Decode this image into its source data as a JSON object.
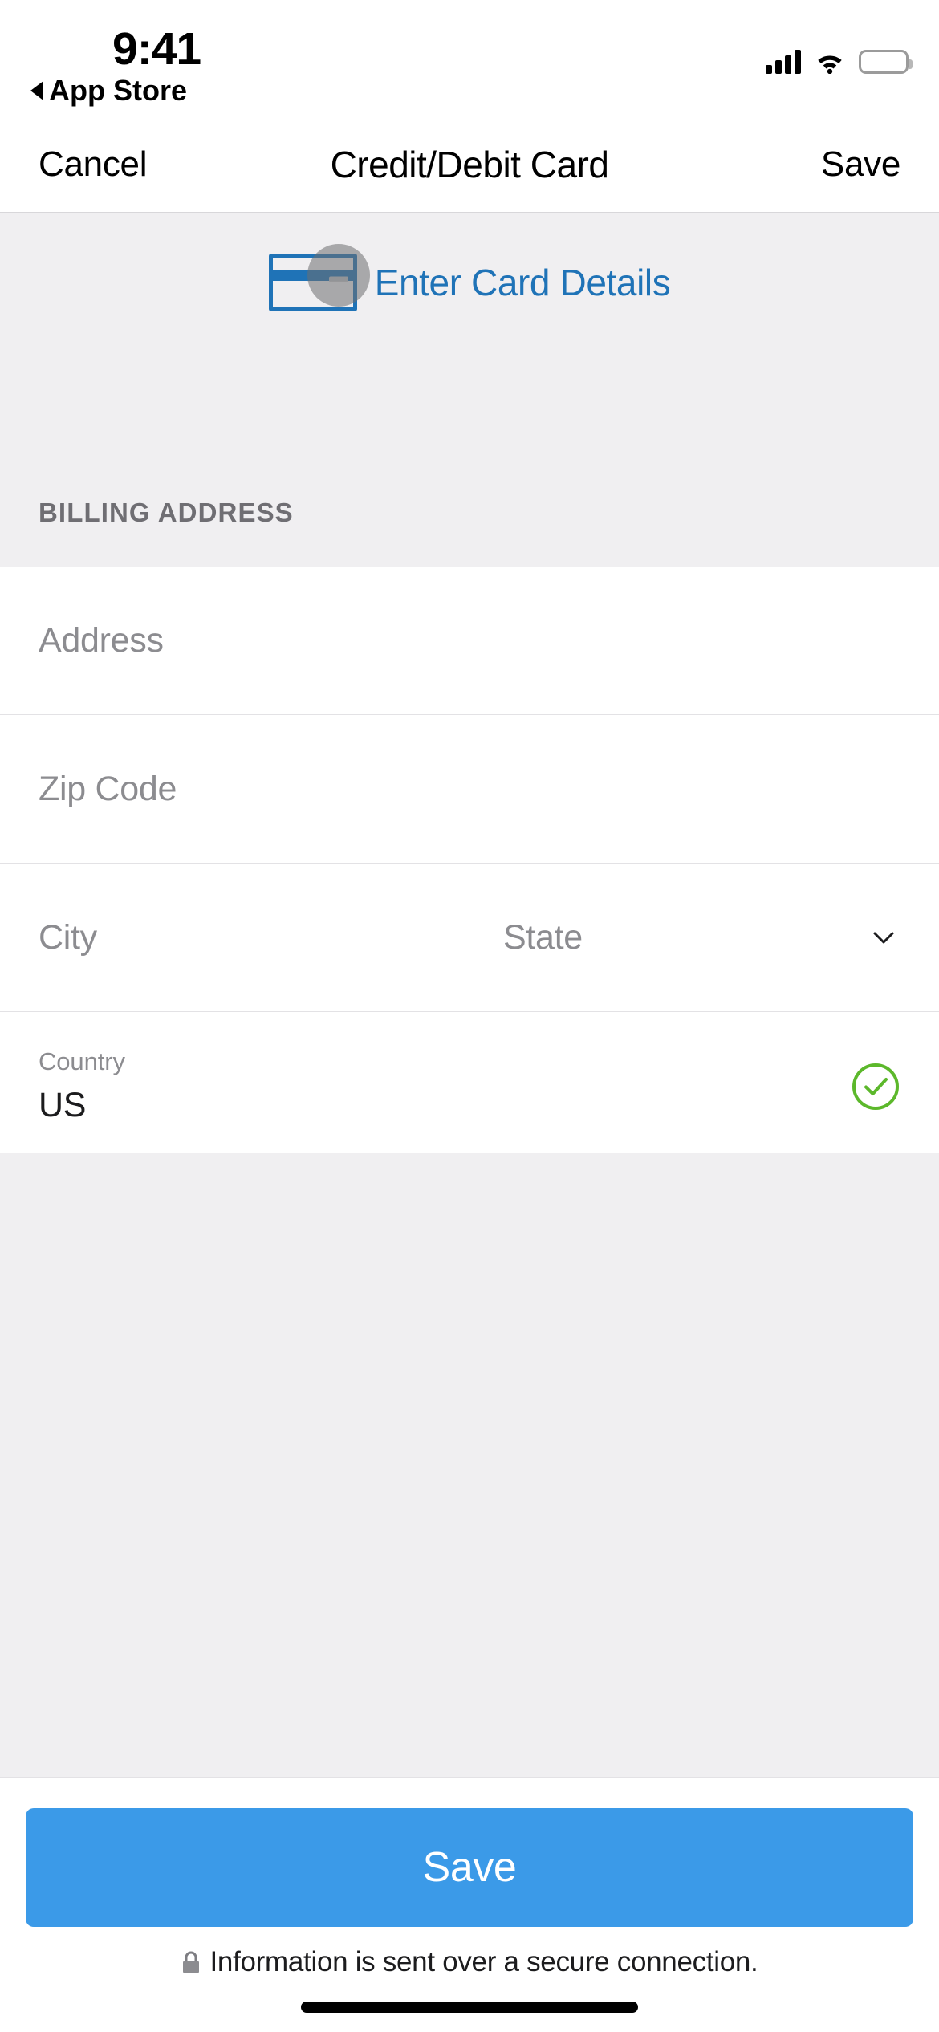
{
  "status_bar": {
    "time": "9:41",
    "back_label": "App Store",
    "back_icon": "triangle-left-icon",
    "signal_icon": "cellular-signal-icon",
    "signal_bars": 4,
    "wifi_icon": "wifi-icon",
    "battery_icon": "battery-full-icon"
  },
  "nav_bar": {
    "cancel_label": "Cancel",
    "title": "Credit/Debit Card",
    "save_label": "Save"
  },
  "card_section": {
    "card_icon": "credit-card-icon",
    "touch_indicator": "touch-pointer-circle",
    "enter_card_label": "Enter Card Details",
    "link_color": "#1f73b7"
  },
  "billing": {
    "section_header": "BILLING ADDRESS",
    "fields": [
      {
        "name": "address",
        "placeholder": "Address",
        "value": ""
      },
      {
        "name": "zip",
        "placeholder": "Zip Code",
        "value": ""
      }
    ],
    "city": {
      "placeholder": "City",
      "value": ""
    },
    "state": {
      "placeholder": "State",
      "value": "",
      "chevron_icon": "chevron-down-icon"
    },
    "country": {
      "label": "Country",
      "value": "US",
      "status_icon": "check-circle-icon",
      "status_color": "#5cb82b"
    }
  },
  "footer": {
    "save_button": "Save",
    "lock_icon": "lock-icon",
    "secure_text": "Information is sent over a secure connection.",
    "button_color": "#3b9ae8"
  }
}
